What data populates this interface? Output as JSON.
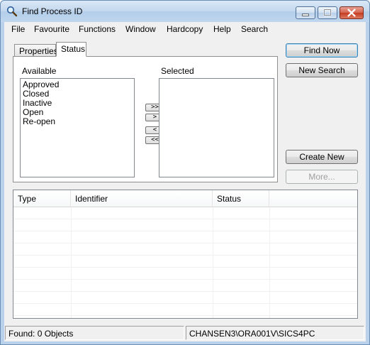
{
  "window": {
    "title": "Find Process ID",
    "icon": "magnifier-icon"
  },
  "menu": [
    "File",
    "Favourite",
    "Functions",
    "Window",
    "Hardcopy",
    "Help",
    "Search"
  ],
  "tabs": [
    {
      "label": "Properties",
      "active": false
    },
    {
      "label": "Status",
      "active": true
    }
  ],
  "status_tab": {
    "available_label": "Available",
    "selected_label": "Selected",
    "available_items": [
      "Approved",
      "Closed",
      "Inactive",
      "Open",
      "Re-open"
    ],
    "selected_items": [],
    "move_buttons": [
      ">>",
      ">",
      "<",
      "<<"
    ]
  },
  "buttons": {
    "find_now": "Find Now",
    "new_search": "New Search",
    "create_new": "Create New",
    "more": "More..."
  },
  "results": {
    "columns": [
      "Type",
      "Identifier",
      "Status",
      ""
    ],
    "rows": []
  },
  "statusbar": {
    "found": "Found: 0 Objects",
    "path": "CHANSEN3\\ORA001V\\SICS4PC"
  }
}
